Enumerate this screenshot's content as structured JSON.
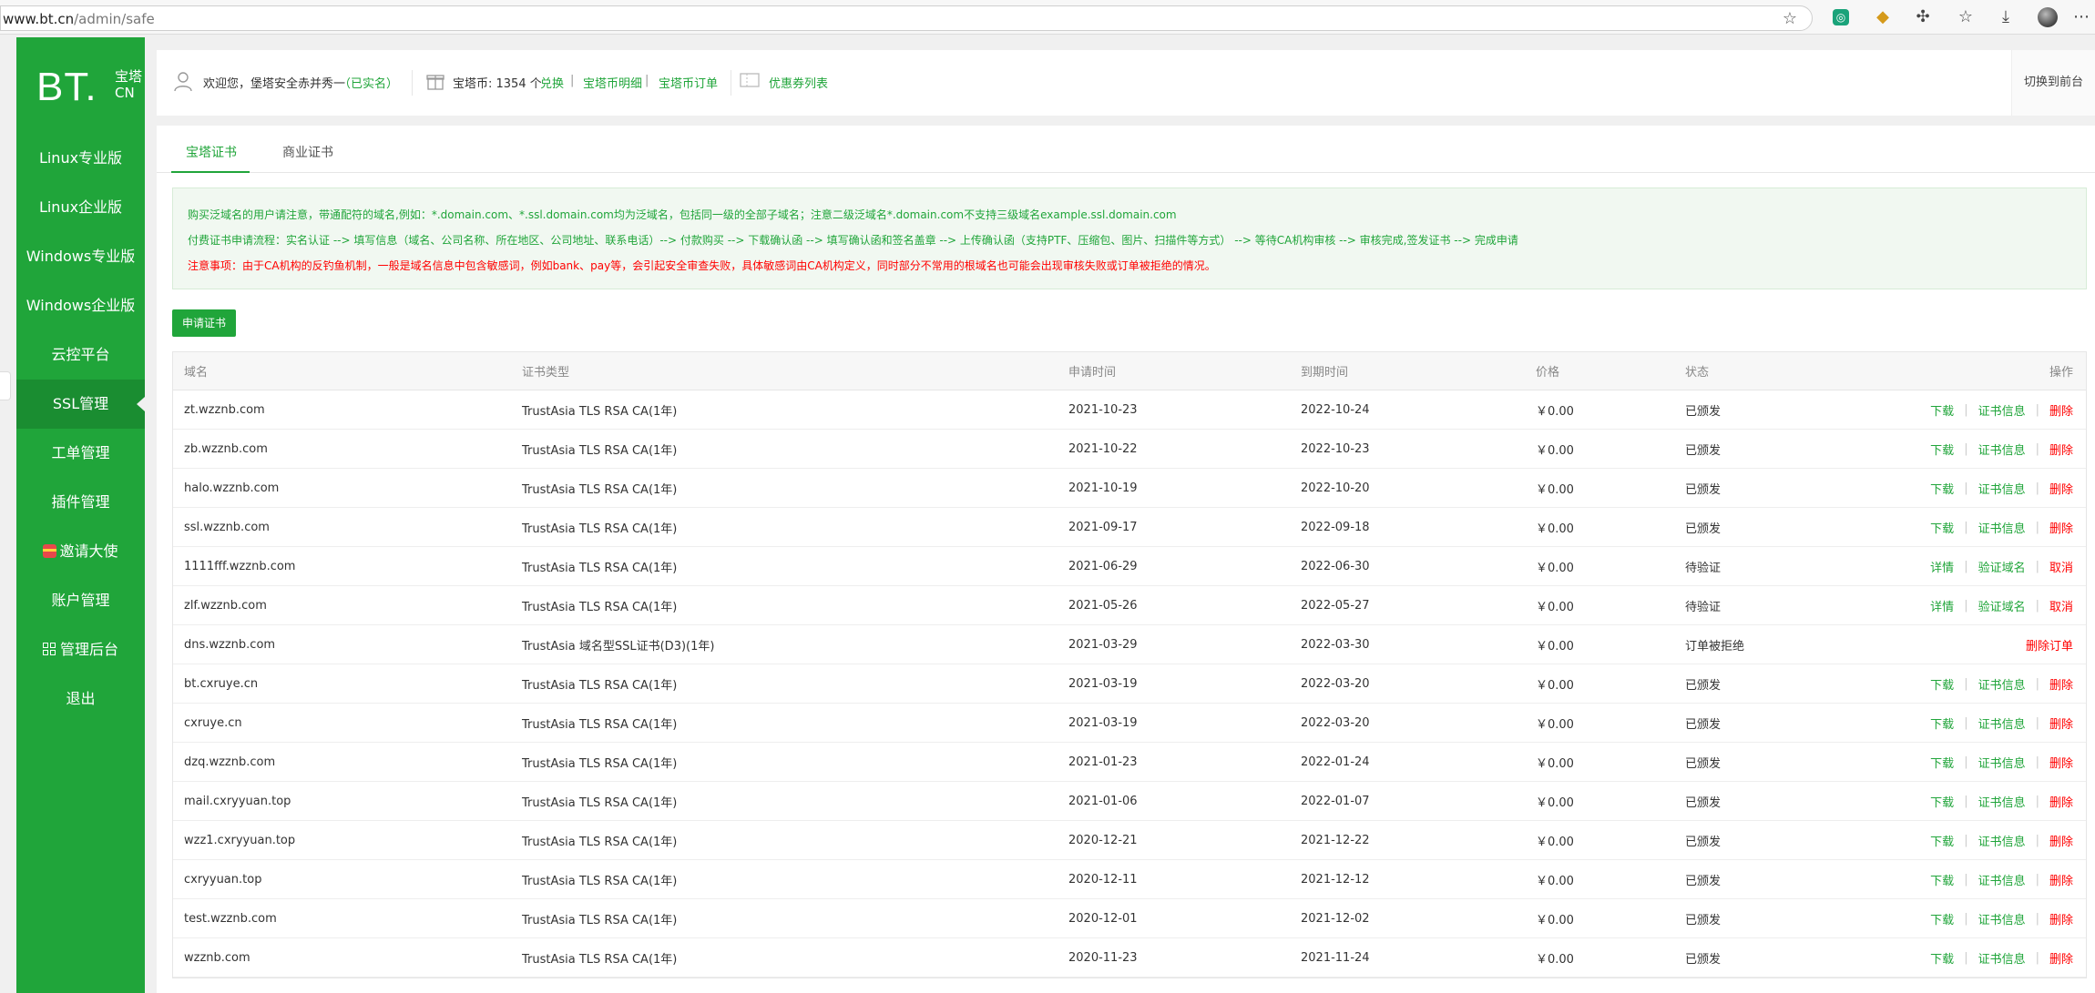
{
  "browser": {
    "url_host": "www.bt.cn",
    "url_path": "/admin/safe"
  },
  "sidebar": {
    "logo_main": "BT.",
    "logo_cn_top": "宝塔",
    "logo_cn_bottom": "CN",
    "items": [
      {
        "label": "Linux专业版"
      },
      {
        "label": "Linux企业版"
      },
      {
        "label": "Windows专业版"
      },
      {
        "label": "Windows企业版"
      },
      {
        "label": "云控平台"
      },
      {
        "label": "SSL管理"
      },
      {
        "label": "工单管理"
      },
      {
        "label": "插件管理"
      },
      {
        "label": "邀请大使"
      },
      {
        "label": "账户管理"
      },
      {
        "label": "管理后台"
      },
      {
        "label": "退出"
      }
    ]
  },
  "topbar": {
    "welcome": "欢迎您，堡塔安全赤并秀一",
    "verified": "（已实名）",
    "coins_label": "宝塔币: 1354 个",
    "exchange": "兑换",
    "coin_detail": "宝塔币明细",
    "coin_orders": "宝塔币订单",
    "coupons": "优惠券列表",
    "switch": "切换到前台"
  },
  "tabs": [
    {
      "label": "宝塔证书"
    },
    {
      "label": "商业证书"
    }
  ],
  "notice": {
    "line1": "购买泛域名的用户请注意，带通配符的域名,例如：*.domain.com、*.ssl.domain.com均为泛域名，包括同一级的全部子域名；注意二级泛域名*.domain.com不支持三级域名example.ssl.domain.com",
    "line2": "付费证书申请流程：实名认证 --> 填写信息（域名、公司名称、所在地区、公司地址、联系电话）--> 付款购买 --> 下载确认函 --> 填写确认函和签名盖章 --> 上传确认函（支持PTF、压缩包、图片、扫描件等方式） --> 等待CA机构审核 --> 审核完成,签发证书 --> 完成申请",
    "line3": "注意事项：由于CA机构的反钓鱼机制，一般是域名信息中包含敏感词，例如bank、pay等，会引起安全审查失败，具体敏感词由CA机构定义，同时部分不常用的根域名也可能会出现审核失败或订单被拒绝的情况。"
  },
  "apply_button": "申请证书",
  "table": {
    "headers": {
      "domain": "域名",
      "type": "证书类型",
      "apply": "申请时间",
      "expire": "到期时间",
      "price": "价格",
      "status": "状态",
      "ops": "操作"
    },
    "rows": [
      {
        "domain": "zt.wzznb.com",
        "type": "TrustAsia TLS RSA CA(1年)",
        "apply": "2021-10-23",
        "expire": "2022-10-24",
        "price": "￥0.00",
        "status": "已颁发",
        "op1": "下载",
        "op2": "证书信息",
        "op3": "删除"
      },
      {
        "domain": "zb.wzznb.com",
        "type": "TrustAsia TLS RSA CA(1年)",
        "apply": "2021-10-22",
        "expire": "2022-10-23",
        "price": "￥0.00",
        "status": "已颁发",
        "op1": "下载",
        "op2": "证书信息",
        "op3": "删除"
      },
      {
        "domain": "halo.wzznb.com",
        "type": "TrustAsia TLS RSA CA(1年)",
        "apply": "2021-10-19",
        "expire": "2022-10-20",
        "price": "￥0.00",
        "status": "已颁发",
        "op1": "下载",
        "op2": "证书信息",
        "op3": "删除"
      },
      {
        "domain": "ssl.wzznb.com",
        "type": "TrustAsia TLS RSA CA(1年)",
        "apply": "2021-09-17",
        "expire": "2022-09-18",
        "price": "￥0.00",
        "status": "已颁发",
        "op1": "下载",
        "op2": "证书信息",
        "op3": "删除"
      },
      {
        "domain": "1111fff.wzznb.com",
        "type": "TrustAsia TLS RSA CA(1年)",
        "apply": "2021-06-29",
        "expire": "2022-06-30",
        "price": "￥0.00",
        "status": "待验证",
        "op1": "详情",
        "op2": "验证域名",
        "op3": "取消"
      },
      {
        "domain": "zlf.wzznb.com",
        "type": "TrustAsia TLS RSA CA(1年)",
        "apply": "2021-05-26",
        "expire": "2022-05-27",
        "price": "￥0.00",
        "status": "待验证",
        "op1": "详情",
        "op2": "验证域名",
        "op3": "取消"
      },
      {
        "domain": "dns.wzznb.com",
        "type": "TrustAsia 域名型SSL证书(D3)(1年)",
        "apply": "2021-03-29",
        "expire": "2022-03-30",
        "price": "￥0.00",
        "status": "订单被拒绝",
        "op1": "",
        "op2": "",
        "op3": "删除订单"
      },
      {
        "domain": "bt.cxruye.cn",
        "type": "TrustAsia TLS RSA CA(1年)",
        "apply": "2021-03-19",
        "expire": "2022-03-20",
        "price": "￥0.00",
        "status": "已颁发",
        "op1": "下载",
        "op2": "证书信息",
        "op3": "删除"
      },
      {
        "domain": "cxruye.cn",
        "type": "TrustAsia TLS RSA CA(1年)",
        "apply": "2021-03-19",
        "expire": "2022-03-20",
        "price": "￥0.00",
        "status": "已颁发",
        "op1": "下载",
        "op2": "证书信息",
        "op3": "删除"
      },
      {
        "domain": "dzq.wzznb.com",
        "type": "TrustAsia TLS RSA CA(1年)",
        "apply": "2021-01-23",
        "expire": "2022-01-24",
        "price": "￥0.00",
        "status": "已颁发",
        "op1": "下载",
        "op2": "证书信息",
        "op3": "删除"
      },
      {
        "domain": "mail.cxryyuan.top",
        "type": "TrustAsia TLS RSA CA(1年)",
        "apply": "2021-01-06",
        "expire": "2022-01-07",
        "price": "￥0.00",
        "status": "已颁发",
        "op1": "下载",
        "op2": "证书信息",
        "op3": "删除"
      },
      {
        "domain": "wzz1.cxryyuan.top",
        "type": "TrustAsia TLS RSA CA(1年)",
        "apply": "2020-12-21",
        "expire": "2021-12-22",
        "price": "￥0.00",
        "status": "已颁发",
        "op1": "下载",
        "op2": "证书信息",
        "op3": "删除"
      },
      {
        "domain": "cxryyuan.top",
        "type": "TrustAsia TLS RSA CA(1年)",
        "apply": "2020-12-11",
        "expire": "2021-12-12",
        "price": "￥0.00",
        "status": "已颁发",
        "op1": "下载",
        "op2": "证书信息",
        "op3": "删除"
      },
      {
        "domain": "test.wzznb.com",
        "type": "TrustAsia TLS RSA CA(1年)",
        "apply": "2020-12-01",
        "expire": "2021-12-02",
        "price": "￥0.00",
        "status": "已颁发",
        "op1": "下载",
        "op2": "证书信息",
        "op3": "删除"
      },
      {
        "domain": "wzznb.com",
        "type": "TrustAsia TLS RSA CA(1年)",
        "apply": "2020-11-23",
        "expire": "2021-11-24",
        "price": "￥0.00",
        "status": "已颁发",
        "op1": "下载",
        "op2": "证书信息",
        "op3": "删除"
      }
    ]
  },
  "colors": {
    "brand_green": "#20a53a",
    "warning_red": "#ff0000"
  }
}
